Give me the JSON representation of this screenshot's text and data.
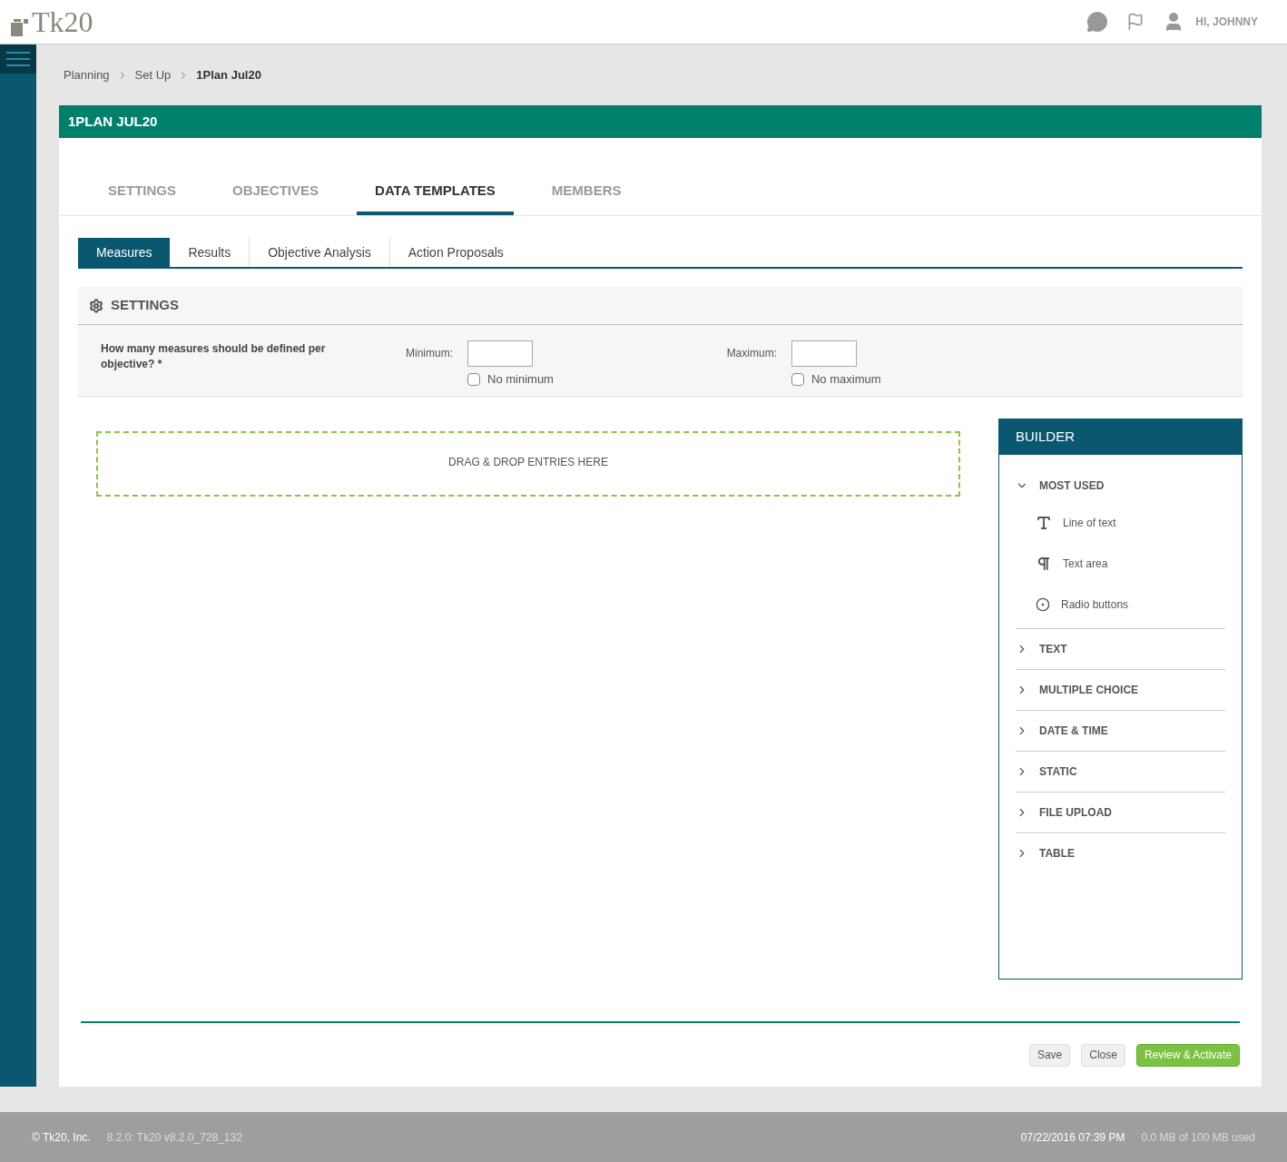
{
  "header": {
    "logo": "Tk20",
    "user": "HI, JOHNNY"
  },
  "breadcrumb": [
    {
      "label": "Planning",
      "current": false
    },
    {
      "label": "Set Up",
      "current": false
    },
    {
      "label": "1Plan Jul20",
      "current": true
    }
  ],
  "card_title": "1PLAN JUL20",
  "tabs": [
    {
      "label": "SETTINGS",
      "selected": false
    },
    {
      "label": "OBJECTIVES",
      "selected": false
    },
    {
      "label": "DATA TEMPLATES",
      "selected": true
    },
    {
      "label": "MEMBERS",
      "selected": false
    }
  ],
  "subtabs": [
    {
      "label": "Measures",
      "selected": true
    },
    {
      "label": "Results",
      "selected": false
    },
    {
      "label": "Objective Analysis",
      "selected": false
    },
    {
      "label": "Action Proposals",
      "selected": false
    }
  ],
  "settings": {
    "title": "SETTINGS",
    "question": "How many measures should be defined per objective? *",
    "minimum": {
      "label": "Minimum:",
      "checkbox": "No minimum",
      "checked": false
    },
    "maximum": {
      "label": "Maximum:",
      "checkbox": "No maximum",
      "checked": false
    }
  },
  "dropzone": "DRAG & DROP ENTRIES HERE",
  "builder": {
    "title": "BUILDER",
    "groups": [
      {
        "label": "MOST USED",
        "expanded": true,
        "children": [
          {
            "label": "Line of text",
            "kind": "text"
          },
          {
            "label": "Text area",
            "kind": "paragraph"
          },
          {
            "label": "Radio buttons",
            "kind": "radio"
          }
        ]
      },
      {
        "label": "TEXT",
        "expanded": false
      },
      {
        "label": "MULTIPLE CHOICE",
        "expanded": false
      },
      {
        "label": "DATE & TIME",
        "expanded": false
      },
      {
        "label": "STATIC",
        "expanded": false
      },
      {
        "label": "FILE UPLOAD",
        "expanded": false
      },
      {
        "label": "TABLE",
        "expanded": false
      }
    ]
  },
  "buttons": [
    {
      "label": "Save",
      "kind": "plain"
    },
    {
      "label": "Close",
      "kind": "plain"
    },
    {
      "label": "Review & Activate",
      "kind": "primary"
    }
  ],
  "footer": {
    "copyright": "© Tk20, Inc.",
    "version": "8.2.0: Tk20 v8.2.0_728_132",
    "timestamp": "07/22/2016 07:39 PM",
    "storage": "0.0 MB of 100 MB used"
  }
}
